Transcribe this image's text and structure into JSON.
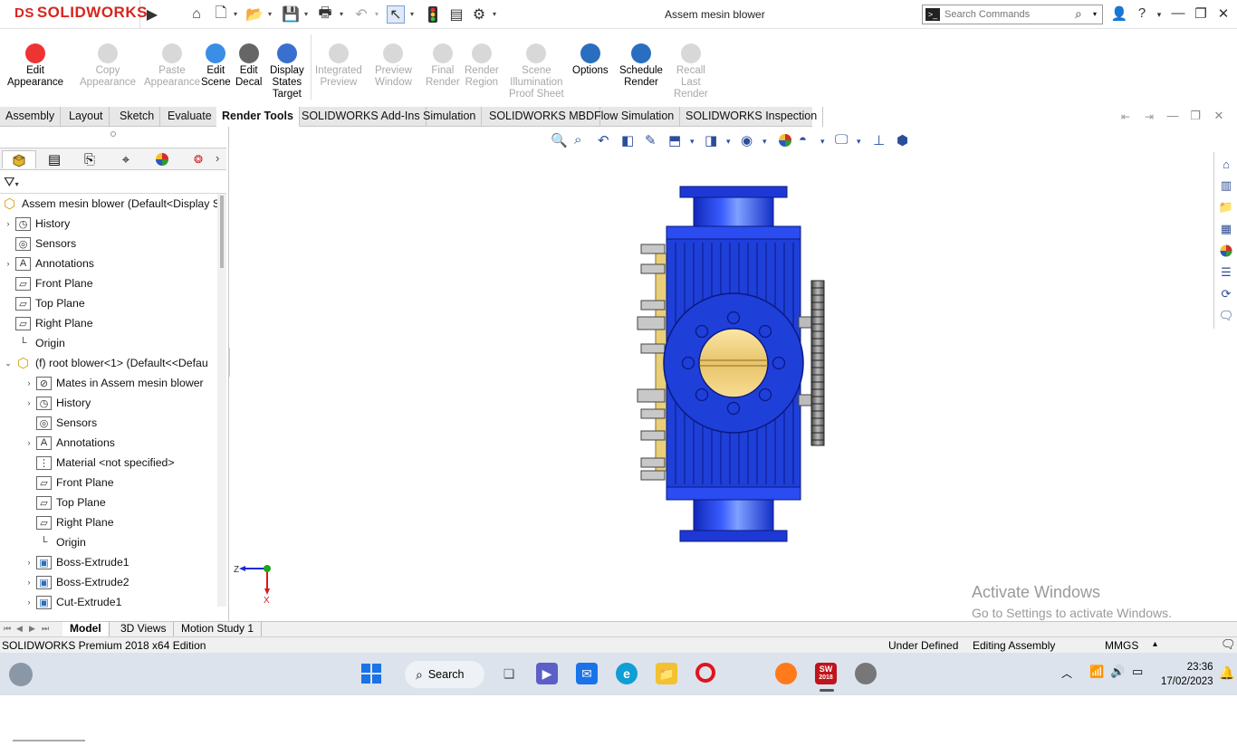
{
  "app": {
    "brand": "SOLIDWORKS",
    "brand_prefix": "DS",
    "document_title": "Assem mesin blower",
    "search_placeholder": "Search Commands"
  },
  "command_manager": [
    {
      "label": "Edit Appearance",
      "lines": [
        "Edit",
        "Appearance"
      ],
      "enabled": true,
      "icon": "edit-appearance-icon"
    },
    {
      "label": "Copy Appearance",
      "lines": [
        "Copy",
        "Appearance"
      ],
      "enabled": false,
      "icon": "copy-appearance-icon"
    },
    {
      "label": "Paste Appearance",
      "lines": [
        "Paste",
        "Appearance"
      ],
      "enabled": false,
      "icon": "paste-appearance-icon"
    },
    {
      "label": "Edit Scene",
      "lines": [
        "Edit",
        "Scene"
      ],
      "enabled": true,
      "icon": "edit-scene-icon"
    },
    {
      "label": "Edit Decal",
      "lines": [
        "Edit",
        "Decal"
      ],
      "enabled": true,
      "icon": "edit-decal-icon"
    },
    {
      "label": "Display States Target",
      "lines": [
        "Display",
        "States",
        "Target"
      ],
      "enabled": true,
      "icon": "display-states-target-icon"
    },
    {
      "label": "Integrated Preview",
      "lines": [
        "Integrated",
        "Preview"
      ],
      "enabled": false,
      "icon": "integrated-preview-icon"
    },
    {
      "label": "Preview Window",
      "lines": [
        "Preview",
        "Window"
      ],
      "enabled": false,
      "icon": "preview-window-icon"
    },
    {
      "label": "Final Render",
      "lines": [
        "Final",
        "Render"
      ],
      "enabled": false,
      "icon": "final-render-icon"
    },
    {
      "label": "Render Region",
      "lines": [
        "Render",
        "Region"
      ],
      "enabled": false,
      "icon": "render-region-icon"
    },
    {
      "label": "Scene Illumination Proof Sheet",
      "lines": [
        "Scene",
        "Illumination",
        "Proof Sheet"
      ],
      "enabled": false,
      "icon": "scene-illumination-icon"
    },
    {
      "label": "Options",
      "lines": [
        "Options"
      ],
      "enabled": true,
      "icon": "options-icon"
    },
    {
      "label": "Schedule Render",
      "lines": [
        "Schedule",
        "Render"
      ],
      "enabled": true,
      "icon": "schedule-render-icon"
    },
    {
      "label": "Recall Last Render",
      "lines": [
        "Recall",
        "Last",
        "Render"
      ],
      "enabled": false,
      "icon": "recall-last-render-icon"
    }
  ],
  "tabs": [
    "Assembly",
    "Layout",
    "Sketch",
    "Evaluate",
    "Render Tools",
    "SOLIDWORKS Add-Ins",
    "Simulation",
    "SOLIDWORKS MBD",
    "Flow Simulation",
    "SOLIDWORKS Inspection"
  ],
  "active_tab": "Render Tools",
  "feature_tree": [
    {
      "label": "Assem mesin blower  (Default<Display S",
      "level": 0,
      "expander": "",
      "icon": "assembly-icon"
    },
    {
      "label": "History",
      "level": 1,
      "expander": "right",
      "icon": "history-icon"
    },
    {
      "label": "Sensors",
      "level": 1,
      "expander": "",
      "icon": "sensors-icon"
    },
    {
      "label": "Annotations",
      "level": 1,
      "expander": "right",
      "icon": "annotations-icon"
    },
    {
      "label": "Front Plane",
      "level": 1,
      "expander": "",
      "icon": "plane-icon"
    },
    {
      "label": "Top Plane",
      "level": 1,
      "expander": "",
      "icon": "plane-icon"
    },
    {
      "label": "Right Plane",
      "level": 1,
      "expander": "",
      "icon": "plane-icon"
    },
    {
      "label": "Origin",
      "level": 1,
      "expander": "",
      "icon": "origin-icon"
    },
    {
      "label": "(f) root blower<1> (Default<<Defau",
      "level": 1,
      "expander": "down",
      "icon": "part-icon"
    },
    {
      "label": "Mates in Assem mesin blower",
      "level": 2,
      "expander": "right",
      "icon": "mates-icon"
    },
    {
      "label": "History",
      "level": 2,
      "expander": "right",
      "icon": "history-icon"
    },
    {
      "label": "Sensors",
      "level": 2,
      "expander": "",
      "icon": "sensors-icon"
    },
    {
      "label": "Annotations",
      "level": 2,
      "expander": "right",
      "icon": "annotations-icon"
    },
    {
      "label": "Material <not specified>",
      "level": 2,
      "expander": "",
      "icon": "material-icon"
    },
    {
      "label": "Front Plane",
      "level": 2,
      "expander": "",
      "icon": "plane-icon"
    },
    {
      "label": "Top Plane",
      "level": 2,
      "expander": "",
      "icon": "plane-icon"
    },
    {
      "label": "Right Plane",
      "level": 2,
      "expander": "",
      "icon": "plane-icon"
    },
    {
      "label": "Origin",
      "level": 2,
      "expander": "",
      "icon": "origin-icon"
    },
    {
      "label": "Boss-Extrude1",
      "level": 2,
      "expander": "right",
      "icon": "extrude-icon"
    },
    {
      "label": "Boss-Extrude2",
      "level": 2,
      "expander": "right",
      "icon": "extrude-icon"
    },
    {
      "label": "Cut-Extrude1",
      "level": 2,
      "expander": "right",
      "icon": "extrude-icon"
    }
  ],
  "triad": {
    "z": "Z",
    "x": "X"
  },
  "watermark": {
    "title": "Activate Windows",
    "subtitle": "Go to Settings to activate Windows."
  },
  "model_tabs": [
    "Model",
    "3D Views",
    "Motion Study 1"
  ],
  "active_model_tab": "Model",
  "status_bar": {
    "edition": "SOLIDWORKS Premium 2018 x64 Edition",
    "definition": "Under Defined",
    "mode": "Editing Assembly",
    "units": "MMGS",
    "units_arrow": "▴"
  },
  "taskbar": {
    "search_label": "Search",
    "time": "23:36",
    "date": "17/02/2023",
    "sw_badge": "2018"
  },
  "colors": {
    "brand_red": "#d7261e",
    "model_blue": "#1f3fd9",
    "bore_yellow": "#f4d98a"
  }
}
